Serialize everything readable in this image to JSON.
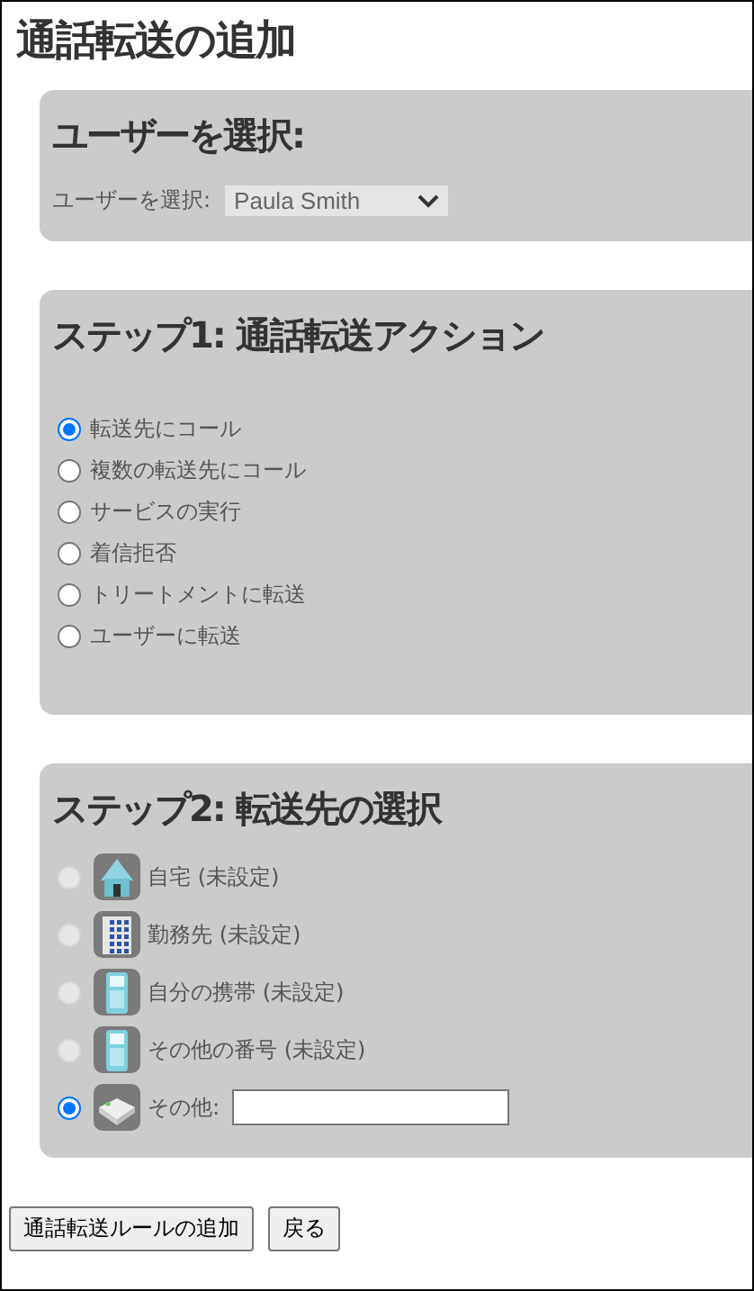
{
  "title": "通話転送の追加",
  "user_panel": {
    "heading": "ユーザーを選択:",
    "label": "ユーザーを選択:",
    "value": "Paula Smith"
  },
  "step1": {
    "heading": "ステップ1: 通話転送アクション",
    "options": [
      {
        "label": "転送先にコール",
        "selected": true
      },
      {
        "label": "複数の転送先にコール",
        "selected": false
      },
      {
        "label": "サービスの実行",
        "selected": false
      },
      {
        "label": "着信拒否",
        "selected": false
      },
      {
        "label": "トリートメントに転送",
        "selected": false
      },
      {
        "label": "ユーザーに転送",
        "selected": false
      }
    ]
  },
  "step2": {
    "heading": "ステップ2: 転送先の選択",
    "destinations": [
      {
        "kind": "home",
        "label": "自宅 (未設定)",
        "selected": false,
        "disabled": true
      },
      {
        "kind": "office",
        "label": "勤務先 (未設定)",
        "selected": false,
        "disabled": true
      },
      {
        "kind": "mobile",
        "label": "自分の携帯 (未設定)",
        "selected": false,
        "disabled": true
      },
      {
        "kind": "mobile",
        "label": "その他の番号 (未設定)",
        "selected": false,
        "disabled": true
      },
      {
        "kind": "other",
        "label": "その他:",
        "selected": true,
        "disabled": false,
        "field": true
      }
    ]
  },
  "buttons": [
    "通話転送ルールの追加",
    "戻る"
  ]
}
